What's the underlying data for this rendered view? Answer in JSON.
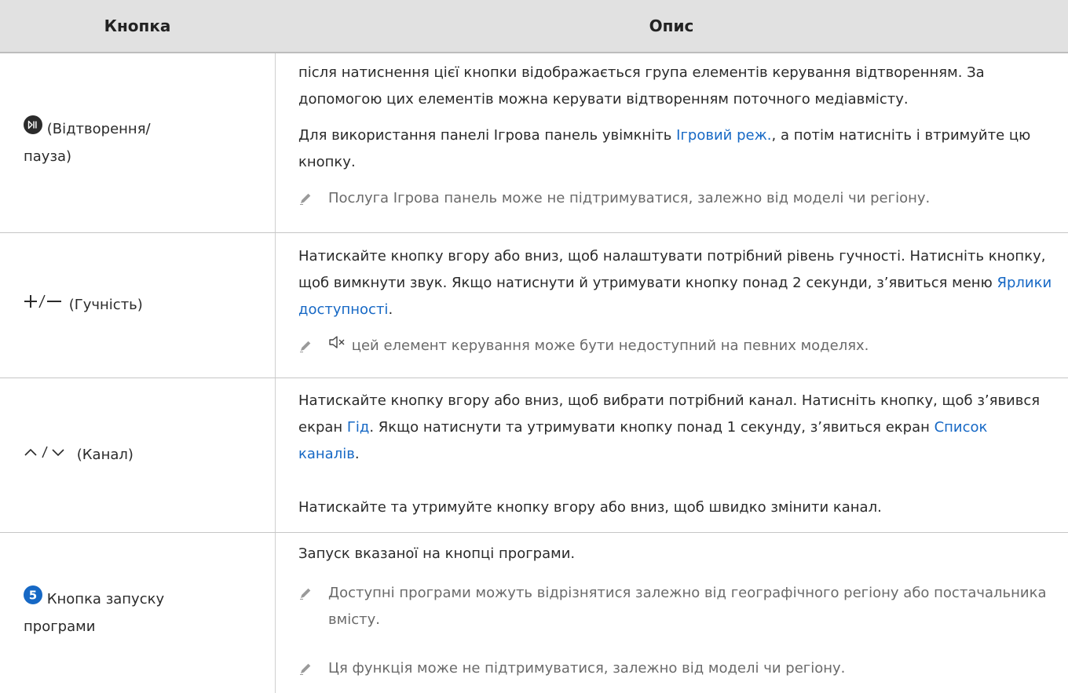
{
  "header": {
    "col_button": "Кнопка",
    "col_desc": "Опис"
  },
  "rows": [
    {
      "button_icon": "play-pause-icon",
      "button_lines": [
        "(Відтворення/",
        "пауза)"
      ],
      "p1": "після натиснення цієї кнопки відображається група елементів керування відтворенням. За допомогою цих елементів можна керувати відтворенням поточного медіавмісту.",
      "p2_pre": "Для використання панелі Ігрова панель увімкніть ",
      "p2_link": "Ігровий реж.",
      "p2_post": ", а потім натисніть і втримуйте цю кнопку.",
      "note": "Послуга Ігрова панель може не підтримуватися, залежно від моделі чи регіону."
    },
    {
      "button_icon": "plus-minus-icon",
      "button_text": "(Гучність)",
      "p1_pre": "Натискайте кнопку вгору або вниз, щоб налаштувати потрібний рівень гучності. Натисніть кнопку, щоб вимкнути звук. Якщо натиснути й утримувати кнопку понад 2 секунди, з’явиться меню ",
      "p1_link": "Ярлики доступності",
      "p1_post": ".",
      "note_icon": "mute-icon",
      "note": "цей елемент керування може бути недоступний на певних моделях."
    },
    {
      "button_icon": "chevron-up-down-icon",
      "button_text": "(Канал)",
      "p1_pre": "Натискайте кнопку вгору або вниз, щоб вибрати потрібний канал. Натисніть кнопку, щоб з’явився екран ",
      "p1_link1": "Гід",
      "p1_mid": ". Якщо натиснути та утримувати кнопку понад 1 секунду, з’явиться екран ",
      "p1_link2": "Список каналів",
      "p1_post": ".",
      "p2": "Натискайте та утримуйте кнопку вгору або вниз, щоб швидко змінити канал."
    },
    {
      "button_number": "5",
      "button_lines": [
        "Кнопка запуску",
        "програми"
      ],
      "p1": "Запуск вказаної на кнопці програми.",
      "note1": "Доступні програми можуть відрізнятися залежно від географічного регіону або постачальника вмісту.",
      "note2": "Ця функція може не підтримуватися, залежно від моделі чи регіону."
    }
  ],
  "colors": {
    "link": "#1668c5",
    "header_bg": "#e1e1e1",
    "note_text": "#6a6a6a"
  }
}
